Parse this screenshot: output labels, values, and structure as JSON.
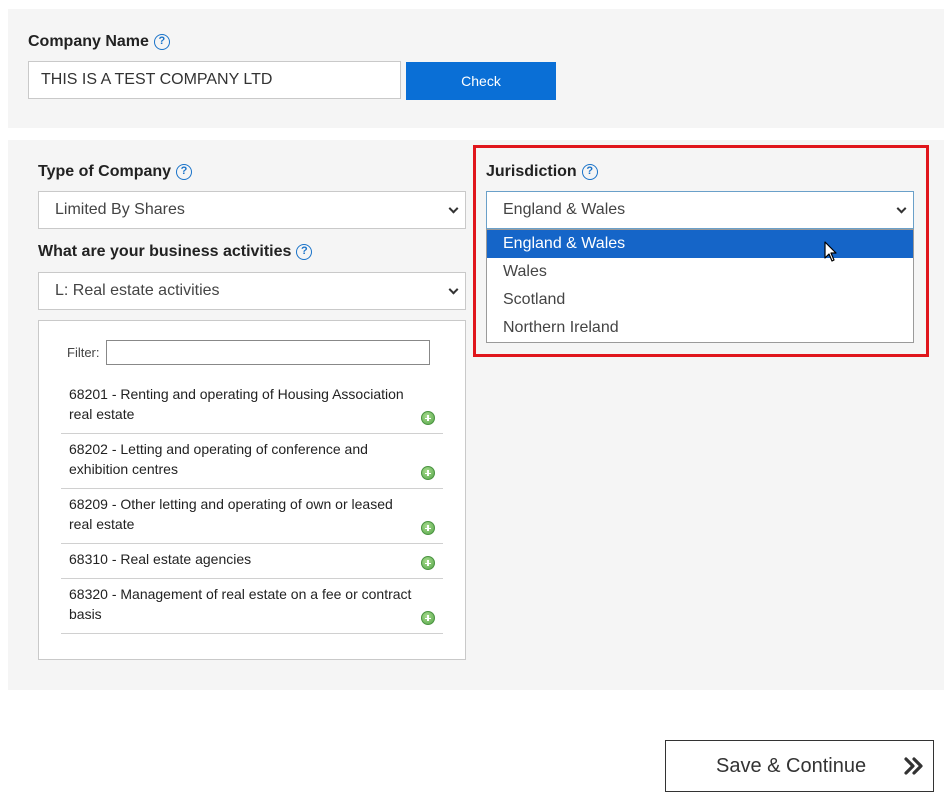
{
  "company_name": {
    "label": "Company Name",
    "help_icon": "?",
    "value": "THIS IS A TEST COMPANY LTD",
    "check_label": "Check"
  },
  "type_of_company": {
    "label": "Type of Company",
    "help_icon": "?",
    "selected": "Limited By Shares"
  },
  "business_activities": {
    "label": "What are your business activities",
    "help_icon": "?",
    "selected": "L: Real estate activities",
    "filter_label": "Filter:",
    "filter_value": "",
    "items": [
      {
        "text": "68201 - Renting and operating of Housing Association real estate"
      },
      {
        "text": "68202 - Letting and operating of conference and exhibition centres"
      },
      {
        "text": "68209 - Other letting and operating of own or leased real estate"
      },
      {
        "text": "68310 - Real estate agencies"
      },
      {
        "text": "68320 - Management of real estate on a fee or contract basis"
      }
    ]
  },
  "jurisdiction": {
    "label": "Jurisdiction",
    "help_icon": "?",
    "selected": "England & Wales",
    "options": [
      {
        "label": "England & Wales",
        "selected": true
      },
      {
        "label": "Wales",
        "selected": false
      },
      {
        "label": "Scotland",
        "selected": false
      },
      {
        "label": "Northern Ireland",
        "selected": false
      }
    ]
  },
  "footer": {
    "save_label": "Save & Continue"
  },
  "colors": {
    "primary": "#0a6fd6",
    "dropdown_selected": "#1565c8",
    "highlight": "#e0161c",
    "panel_bg": "#f5f5f5",
    "add_icon": "#56a64a"
  },
  "icons": {
    "help": "question-circle-icon",
    "select_arrow": "chevron-down-icon",
    "add": "plus-circle-icon",
    "save": "double-chevron-right-icon",
    "cursor": "mouse-pointer-icon"
  }
}
